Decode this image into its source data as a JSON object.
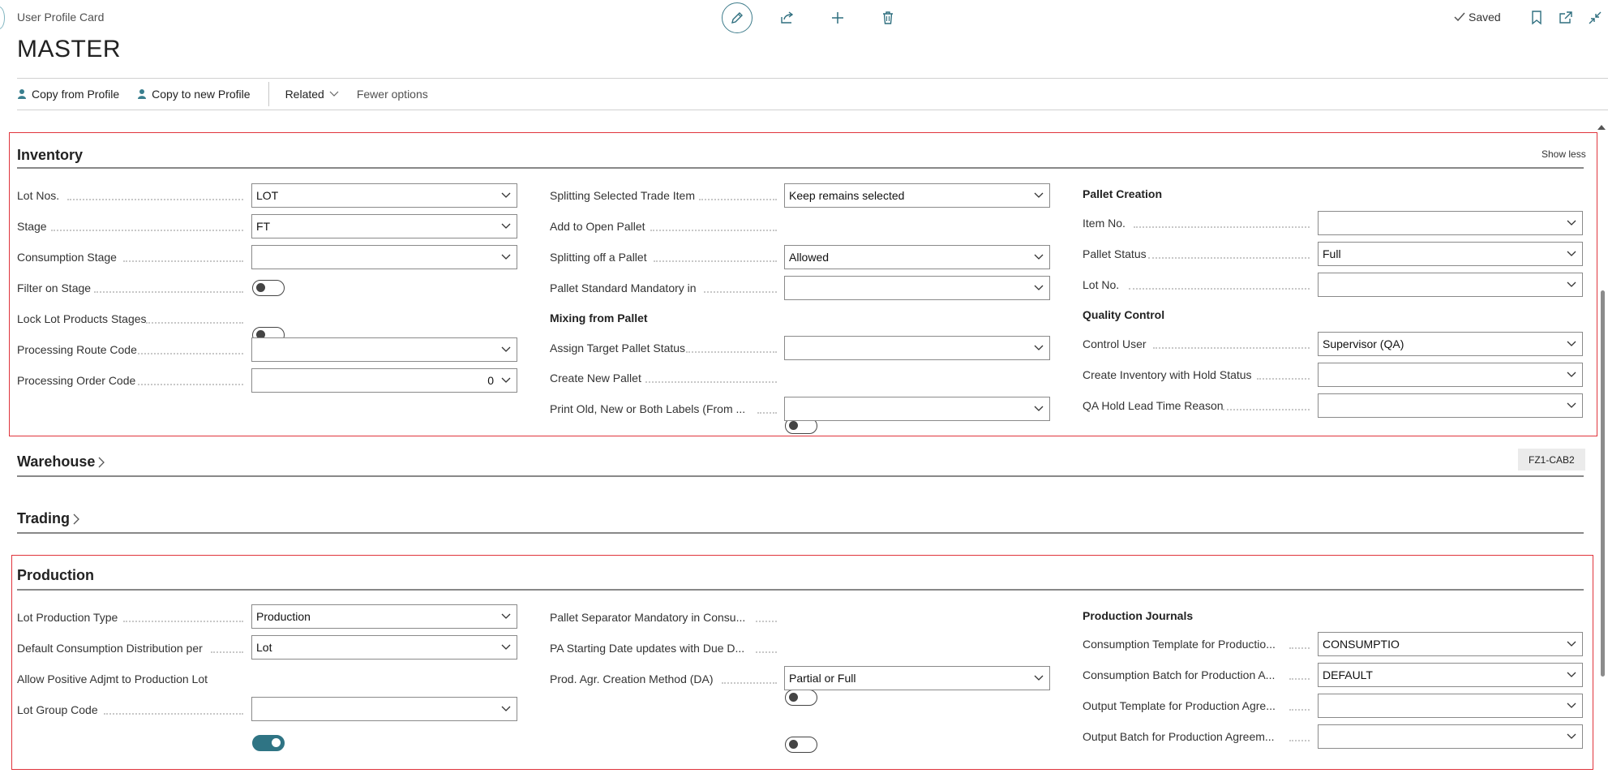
{
  "header": {
    "card_title": "User Profile Card",
    "record_title": "MASTER",
    "saved_label": "Saved"
  },
  "actions": {
    "copy_from_profile": "Copy from Profile",
    "copy_to_new_profile": "Copy to new Profile",
    "related": "Related",
    "fewer_options": "Fewer options"
  },
  "inventory": {
    "title": "Inventory",
    "show_less": "Show less",
    "col1": [
      {
        "label": "Lot Nos.",
        "value": "LOT"
      },
      {
        "label": "Stage",
        "value": "FT"
      },
      {
        "label": "Consumption Stage",
        "value": ""
      },
      {
        "label": "Filter on Stage",
        "toggle": false
      },
      {
        "label": "Lock Lot Products Stages",
        "toggle": false
      },
      {
        "label": "Processing Route Code",
        "value": ""
      },
      {
        "label": "Processing Order Code",
        "value": "0"
      }
    ],
    "col2": {
      "splitting_selected_label": "Splitting Selected Trade Item",
      "splitting_selected_value": "Keep remains selected",
      "add_to_open_pallet_label": "Add to Open Pallet",
      "add_to_open_pallet_on": true,
      "splitting_off_label": "Splitting off a Pallet",
      "splitting_off_value": "Allowed",
      "pallet_standard_label": "Pallet Standard Mandatory in",
      "pallet_standard_value": "",
      "mixing_heading": "Mixing from Pallet",
      "assign_target_label": "Assign Target Pallet Status",
      "assign_target_value": "",
      "create_new_pallet_label": "Create New Pallet",
      "create_new_pallet_on": false,
      "print_labels_label": "Print Old, New or Both Labels (From ...",
      "print_labels_value": ""
    },
    "col3": {
      "pallet_creation_heading": "Pallet Creation",
      "item_no_label": "Item No.",
      "item_no_value": "",
      "pallet_status_label": "Pallet Status",
      "pallet_status_value": "Full",
      "lot_no_label": "Lot No.",
      "lot_no_value": "",
      "qc_heading": "Quality Control",
      "control_user_label": "Control User",
      "control_user_value": "Supervisor (QA)",
      "create_inv_hold_label": "Create Inventory with Hold Status",
      "create_inv_hold_value": "",
      "qa_hold_label": "QA Hold Lead Time Reason",
      "qa_hold_value": ""
    }
  },
  "warehouse": {
    "title": "Warehouse",
    "badge": "FZ1-CAB2"
  },
  "trading": {
    "title": "Trading"
  },
  "production": {
    "title": "Production",
    "col1": {
      "lot_prod_type_label": "Lot Production Type",
      "lot_prod_type_value": "Production",
      "default_consumption_label": "Default Consumption Distribution per",
      "default_consumption_value": "Lot",
      "allow_positive_label": "Allow Positive Adjmt to Production Lot",
      "allow_positive_on": true,
      "lot_group_label": "Lot Group Code",
      "lot_group_value": ""
    },
    "col2": {
      "pallet_separator_label": "Pallet Separator Mandatory in Consu...",
      "pallet_separator_on": false,
      "pa_starting_label": "PA Starting Date updates with Due D...",
      "pa_starting_on": false,
      "prod_agr_label": "Prod. Agr. Creation Method (DA)",
      "prod_agr_value": "Partial or Full"
    },
    "col3": {
      "journals_heading": "Production Journals",
      "cons_template_label": "Consumption Template for Productio...",
      "cons_template_value": "CONSUMPTIO",
      "cons_batch_label": "Consumption Batch for Production A...",
      "cons_batch_value": "DEFAULT",
      "out_template_label": "Output Template for Production Agre...",
      "out_template_value": "",
      "out_batch_label": "Output Batch for Production Agreem...",
      "out_batch_value": ""
    }
  },
  "colors": {
    "accent": "#2f7484",
    "highlight_border": "#e0343c"
  }
}
